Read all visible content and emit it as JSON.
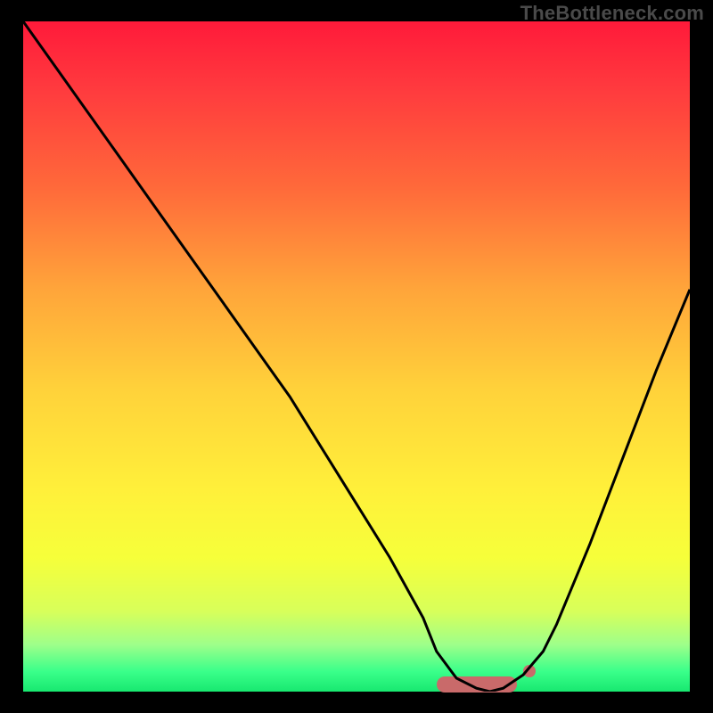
{
  "watermark": "TheBottleneck.com",
  "colors": {
    "curve": "#000000",
    "accent": "#c96a6a",
    "grad_top": "#ff1a3a",
    "grad_bottom": "#18e870"
  },
  "chart_data": {
    "type": "line",
    "title": "",
    "xlabel": "",
    "ylabel": "",
    "xlim": [
      0,
      100
    ],
    "ylim": [
      0,
      100
    ],
    "grid": false,
    "legend": false,
    "series": [
      {
        "name": "bottleneck-curve",
        "x": [
          0,
          5,
          10,
          15,
          20,
          25,
          30,
          35,
          40,
          45,
          50,
          55,
          60,
          62,
          65,
          68,
          70,
          72,
          75,
          78,
          80,
          85,
          90,
          95,
          100
        ],
        "values": [
          100,
          93,
          86,
          79,
          72,
          65,
          58,
          51,
          44,
          36,
          28,
          20,
          11,
          6,
          2,
          0.5,
          0,
          0.5,
          2.5,
          6,
          10,
          22,
          35,
          48,
          60
        ]
      }
    ],
    "annotations": [
      {
        "name": "optimal-band",
        "x_start": 62,
        "x_end": 74,
        "y": 1
      },
      {
        "name": "marker-dot",
        "x": 76,
        "y": 3
      }
    ]
  }
}
